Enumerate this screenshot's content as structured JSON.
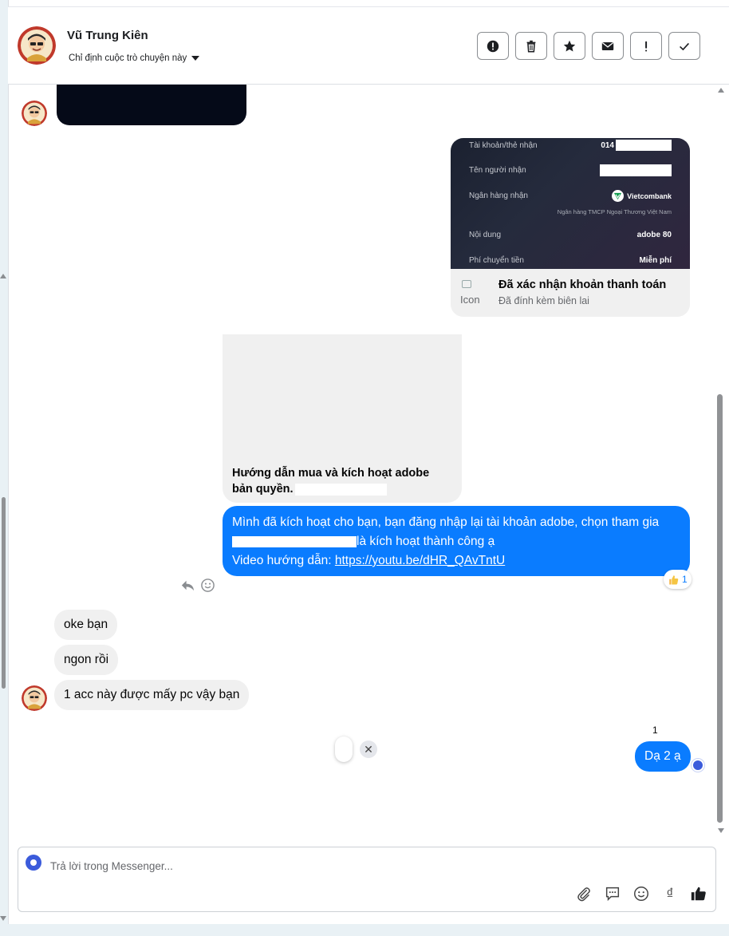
{
  "header": {
    "name": "Vũ Trung Kiên",
    "assign_label": "Chỉ định cuộc trò chuyện này",
    "actions": [
      "spam-icon",
      "trash-icon",
      "star-icon",
      "mail-icon",
      "important-icon",
      "check-icon"
    ]
  },
  "receipt": {
    "rows": [
      {
        "label": "Tài khoản/thẻ nhận",
        "value": "014"
      },
      {
        "label": "Tên người nhận",
        "value": ""
      },
      {
        "label": "Ngân hàng nhận",
        "value": "Vietcombank"
      },
      {
        "label": "Nội dung",
        "value": "adobe 80"
      },
      {
        "label": "Phí chuyển tiền",
        "value": "Miễn phí"
      }
    ],
    "bank_full_name": "Ngân hàng TMCP Ngoại Thương Việt Nam",
    "broken_icon_alt": "Icon",
    "title": "Đã xác nhận khoản thanh toán",
    "subtitle": "Đã đính kèm biên lai"
  },
  "guide": {
    "line1": "Hướng dẫn mua và kích hoạt adobe",
    "line2": "bản quyền."
  },
  "blue_message": {
    "line1": "Mình đã kích hoạt cho bạn, bạn đăng nhập lại tài khoản adobe, chọn tham gia",
    "line2_tail": "là kích hoạt thành công ạ",
    "line3_prefix": "Video hướng dẫn: ",
    "link": "https://youtu.be/dHR_QAvTntU",
    "reaction_count": "1"
  },
  "incoming": [
    {
      "text": "oke bạn"
    },
    {
      "text": "ngon rồi"
    },
    {
      "text": "1 acc này được mấy pc vậy bạn"
    }
  ],
  "outgoing_last": {
    "seen_count": "1",
    "text": "Dạ 2 ạ"
  },
  "composer": {
    "placeholder": "Trả lời trong Messenger...",
    "currency_symbol": "₫"
  },
  "colors": {
    "accent": "#0a7cff",
    "bubble_grey": "#f0f0f0"
  }
}
